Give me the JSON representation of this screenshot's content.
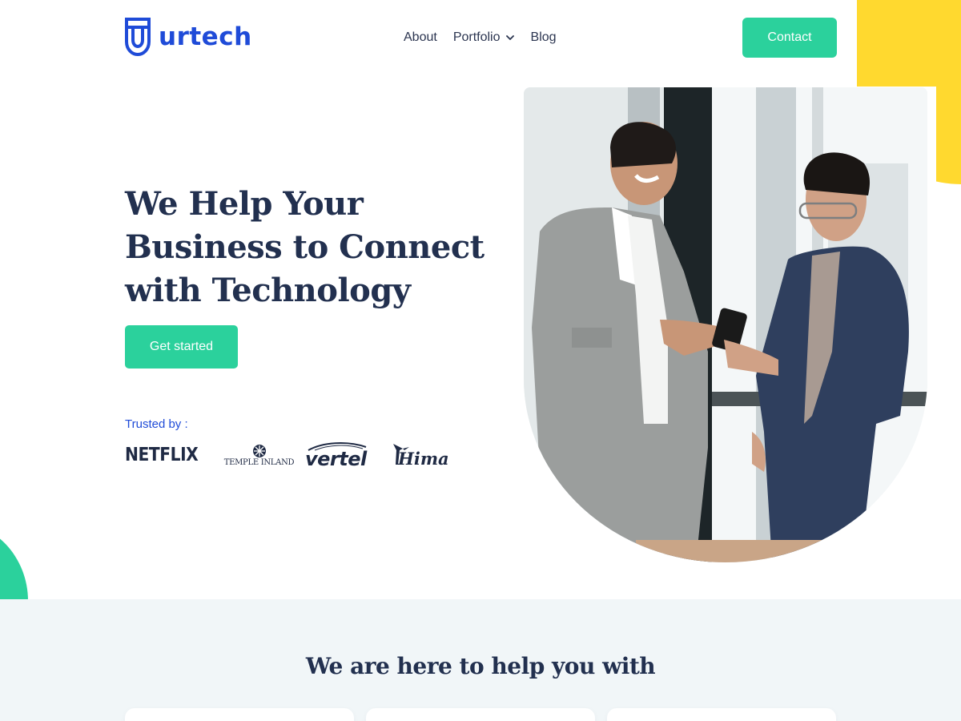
{
  "header": {
    "logo_text": "urtech",
    "logo_icon": "shield-u-icon",
    "nav": [
      {
        "label": "About",
        "icon": null
      },
      {
        "label": "Portfolio",
        "icon": "chevron-down-icon"
      },
      {
        "label": "Blog",
        "icon": null
      }
    ],
    "contact_label": "Contact"
  },
  "hero": {
    "title_lines": [
      "We Help Your",
      "Business to Connect",
      "with Technology"
    ],
    "cta_label": "Get started",
    "trusted_label": "Trusted by :",
    "brands": [
      "NETFLIX",
      "TEMPLE INLAND",
      "vertel",
      "Hima"
    ]
  },
  "services": {
    "title": "We are here to help you with",
    "card_count": 3
  },
  "colors": {
    "accent_green": "#2bd19c",
    "brand_blue": "#1f4bd8",
    "heading": "#22304f",
    "yellow": "#ffd92f",
    "section_bg": "#f1f6f8"
  }
}
